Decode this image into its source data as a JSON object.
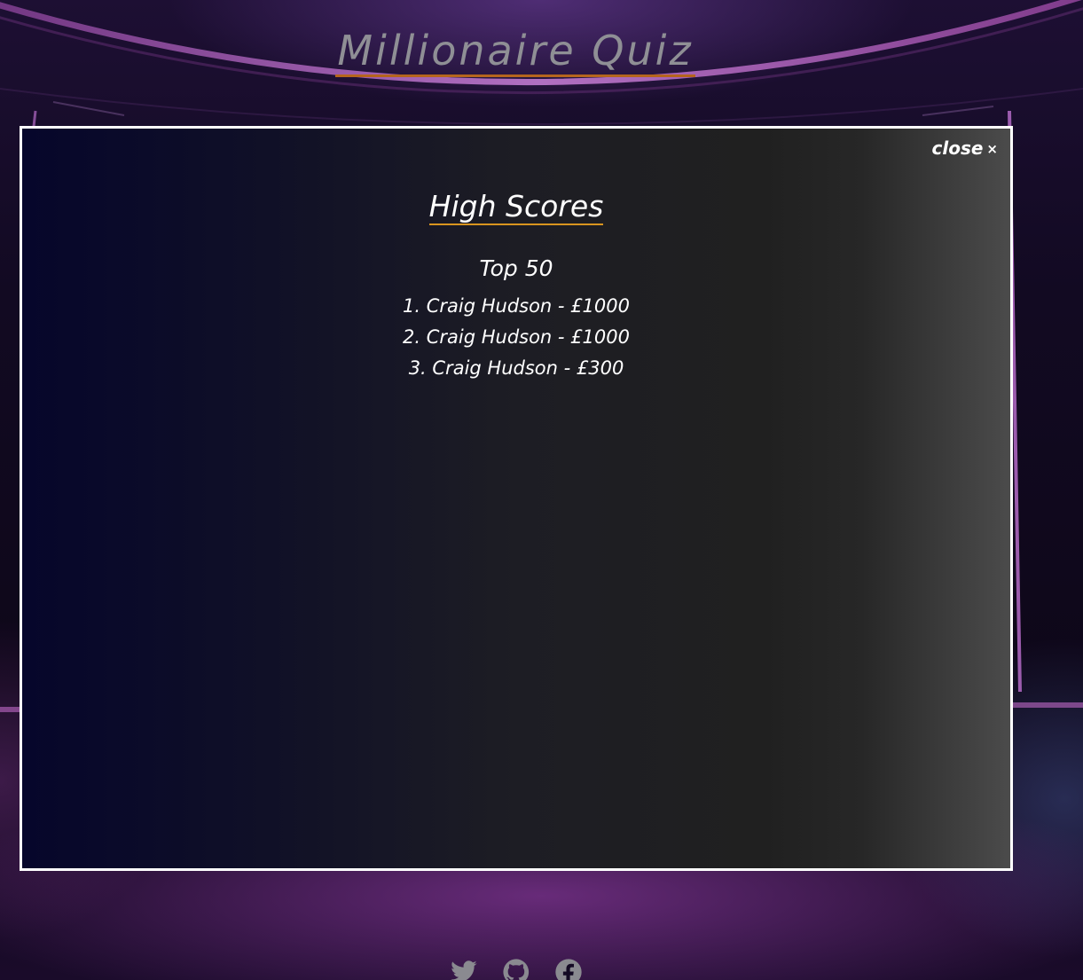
{
  "app": {
    "title": "Millionaire Quiz"
  },
  "modal": {
    "close_label": "close",
    "close_glyph": "×",
    "heading": "High Scores",
    "subheading": "Top 50",
    "scores": [
      {
        "text": "1. Craig Hudson - £1000"
      },
      {
        "text": "2. Craig Hudson - £1000"
      },
      {
        "text": "3. Craig Hudson - £300"
      }
    ]
  },
  "footer": {
    "social": [
      {
        "icon": "twitter-icon"
      },
      {
        "icon": "github-icon"
      },
      {
        "icon": "facebook-icon"
      }
    ]
  },
  "colors": {
    "title_text": "#8f8f95",
    "title_underline": "#b5651d",
    "heading_underline": "#d9951f",
    "modal_border": "#ffffff",
    "stage_accent": "#b45ec8"
  }
}
